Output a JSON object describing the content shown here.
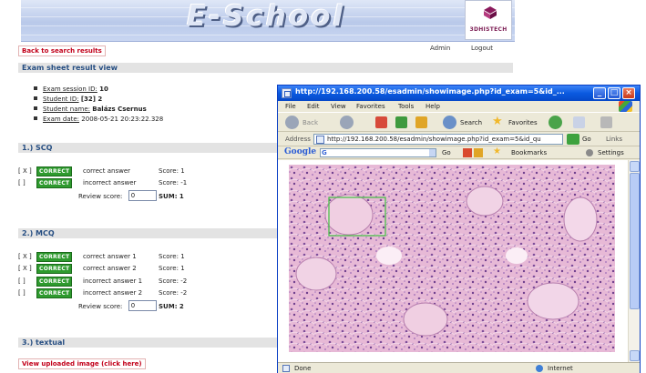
{
  "header": {
    "logo_text": "E-School",
    "brand": "3DHISTECH",
    "admin": "Admin",
    "logout": "Logout"
  },
  "nav": {
    "back": "Back to search results"
  },
  "title": "Exam sheet result view",
  "info": [
    {
      "label": "Exam session ID:",
      "value": "10"
    },
    {
      "label": "Student ID:",
      "value": "[32] 2"
    },
    {
      "label": "Student name:",
      "value": "Balázs Csernus"
    },
    {
      "label": "Exam date:",
      "value": "2008-05-21 20:23:22.328"
    }
  ],
  "sections": {
    "scq": {
      "title": "1.) SCQ",
      "rows": [
        {
          "mark": "[ X ]",
          "badge": "CORRECT",
          "answer": "correct answer",
          "score": "Score: 1"
        },
        {
          "mark": "[   ]",
          "badge": "CORRECT",
          "answer": "incorrect answer",
          "score": "Score: -1"
        }
      ],
      "review_label": "Review score:",
      "review_value": "0",
      "sum": "SUM: 1"
    },
    "mcq": {
      "title": "2.) MCQ",
      "rows": [
        {
          "mark": "[ X ]",
          "badge": "CORRECT",
          "answer": "correct answer 1",
          "score": "Score: 1"
        },
        {
          "mark": "[ X ]",
          "badge": "CORRECT",
          "answer": "correct answer 2",
          "score": "Score: 1"
        },
        {
          "mark": "[   ]",
          "badge": "CORRECT",
          "answer": "incorrect answer 1",
          "score": "Score: -2"
        },
        {
          "mark": "[   ]",
          "badge": "CORRECT",
          "answer": "incorrect answer 2",
          "score": "Score: -2"
        }
      ],
      "review_label": "Review score:",
      "review_value": "0",
      "sum": "SUM: 2"
    },
    "textual": {
      "title": "3.) textual",
      "view_image": "View uploaded image (click here)"
    }
  },
  "popup": {
    "title": "http://192.168.200.58/esadmin/showimage.php?id_exam=5&id_...",
    "menu": [
      "File",
      "Edit",
      "View",
      "Favorites",
      "Tools",
      "Help"
    ],
    "toolbar": {
      "back": "Back",
      "search": "Search",
      "favorites": "Favorites"
    },
    "address_label": "Address",
    "address": "http://192.168.200.58/esadmin/showimage.php?id_exam=5&id_qu",
    "go": "Go",
    "links": "Links",
    "google": {
      "logo": "Google",
      "g": "G",
      "go": "Go",
      "bookmarks": "Bookmarks",
      "settings": "Settings"
    },
    "status": "Done",
    "zone": "Internet"
  },
  "colors": {
    "section_title": "#264e82",
    "link_red": "#c2001a",
    "correct_badge": "#2e9a2e",
    "titlebar": "#0a5ae0"
  }
}
